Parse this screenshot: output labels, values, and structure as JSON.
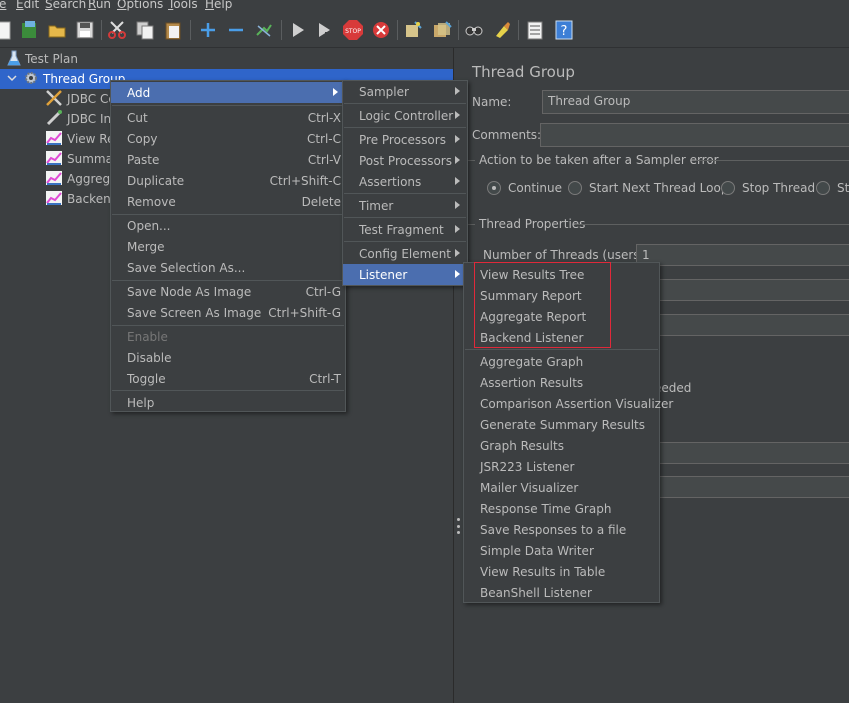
{
  "menubar": {
    "items": [
      "e",
      "Edit",
      "Search",
      "Run",
      "Options",
      "Tools",
      "Help"
    ]
  },
  "toolbar": {
    "icons": [
      "new-icon",
      "templates-icon",
      "open-icon",
      "save-icon",
      "cut-icon",
      "copy-icon",
      "paste-icon",
      "expand-icon",
      "collapse-icon",
      "toggle-icon",
      "start-icon",
      "start-no-pause-icon",
      "stop-icon",
      "shutdown-icon",
      "clear-icon",
      "clear-all-icon",
      "search-icon",
      "reset-search-icon",
      "function-helper-icon",
      "help-icon"
    ]
  },
  "tree": {
    "items": [
      {
        "label": "Test Plan",
        "icon": "test-plan-icon"
      },
      {
        "label": "Thread Group",
        "icon": "thread-group-gear-icon"
      },
      {
        "label": "JDBC Co",
        "icon": "jdbc-config-icon"
      },
      {
        "label": "JDBC Ins",
        "icon": "jdbc-sampler-icon"
      },
      {
        "label": "View Re",
        "icon": "listener-icon"
      },
      {
        "label": "Summa",
        "icon": "listener-icon"
      },
      {
        "label": "Aggrega",
        "icon": "listener-icon"
      },
      {
        "label": "Backend",
        "icon": "listener-icon"
      }
    ]
  },
  "context_menu": {
    "items": [
      {
        "label": "Add",
        "submenu": true,
        "active": true
      },
      {
        "label": "Cut",
        "shortcut": "Ctrl-X"
      },
      {
        "label": "Copy",
        "shortcut": "Ctrl-C"
      },
      {
        "label": "Paste",
        "shortcut": "Ctrl-V"
      },
      {
        "label": "Duplicate",
        "shortcut": "Ctrl+Shift-C"
      },
      {
        "label": "Remove",
        "shortcut": "Delete"
      },
      {
        "label": "Open..."
      },
      {
        "label": "Merge"
      },
      {
        "label": "Save Selection As..."
      },
      {
        "label": "Save Node As Image",
        "shortcut": "Ctrl-G"
      },
      {
        "label": "Save Screen As Image",
        "shortcut": "Ctrl+Shift-G"
      },
      {
        "label": "Enable",
        "disabled": true
      },
      {
        "label": "Disable"
      },
      {
        "label": "Toggle",
        "shortcut": "Ctrl-T"
      },
      {
        "label": "Help"
      }
    ]
  },
  "add_menu": {
    "items": [
      {
        "label": "Sampler"
      },
      {
        "label": "Logic Controller"
      },
      {
        "label": "Pre Processors"
      },
      {
        "label": "Post Processors"
      },
      {
        "label": "Assertions"
      },
      {
        "label": "Timer"
      },
      {
        "label": "Test Fragment"
      },
      {
        "label": "Config Element"
      },
      {
        "label": "Listener",
        "active": true
      }
    ]
  },
  "listener_menu": {
    "items": [
      "View Results Tree",
      "Summary Report",
      "Aggregate Report",
      "Backend Listener",
      "Aggregate Graph",
      "Assertion Results",
      "Comparison Assertion Visualizer",
      "Generate Summary Results",
      "Graph Results",
      "JSR223 Listener",
      "Mailer Visualizer",
      "Response Time Graph",
      "Save Responses to a file",
      "Simple Data Writer",
      "View Results in Table",
      "BeanShell Listener"
    ]
  },
  "form": {
    "title": "Thread Group",
    "name_label": "Name:",
    "name_value": "Thread Group",
    "comments_label": "Comments:",
    "comments_value": "",
    "action_group_label": "Action to be taken after a Sampler error",
    "actions": [
      {
        "label": "Continue",
        "checked": true
      },
      {
        "label": "Start Next Thread Loop",
        "checked": false
      },
      {
        "label": "Stop Thread",
        "checked": false
      },
      {
        "label": "St",
        "checked": false
      }
    ],
    "thread_props_label": "Thread Properties",
    "threads_label": "Number of Threads (users):",
    "threads_value": "1",
    "partial_text": "eeded"
  },
  "colors": {
    "background": "#3c3f41",
    "selection": "#2f65ca",
    "menu_active": "#4b6eaf",
    "highlight_box": "#e0293a"
  }
}
